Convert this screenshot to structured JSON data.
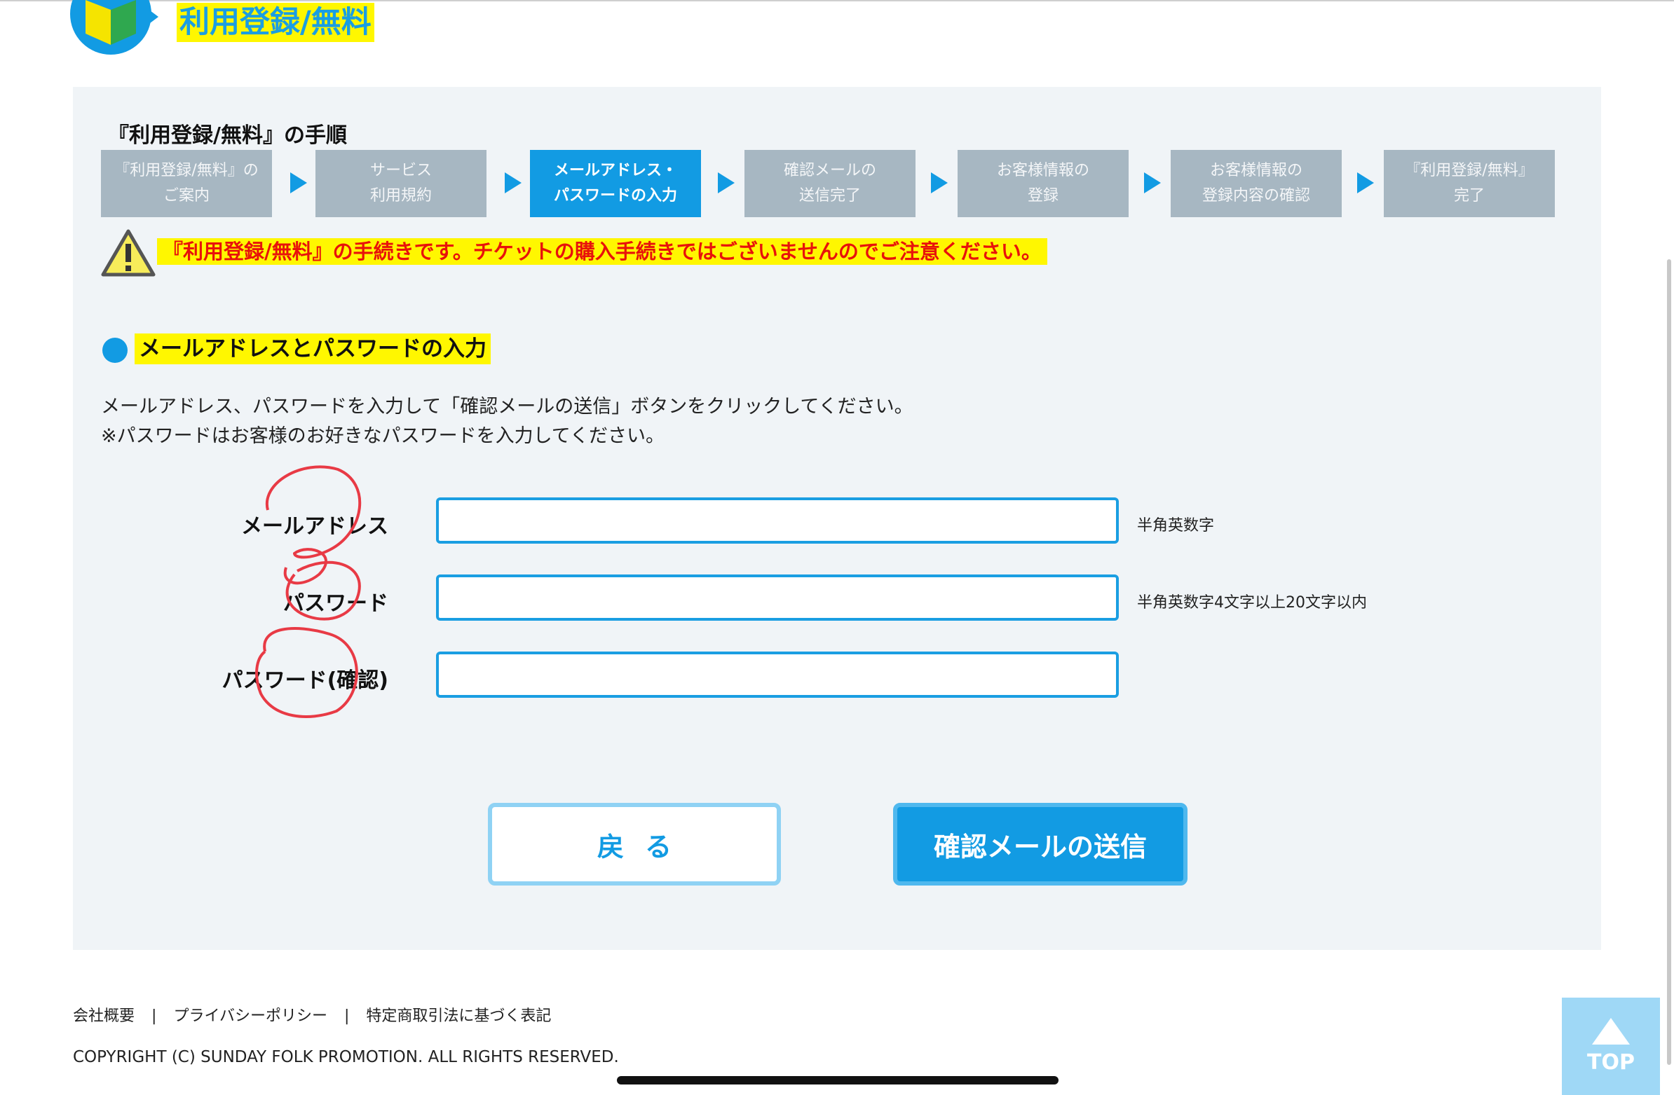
{
  "header": {
    "title": "利用登録/無料"
  },
  "steps": {
    "title": "『利用登録/無料』の手順",
    "items": [
      {
        "label": "『利用登録/無料』の\nご案内"
      },
      {
        "label": "サービス\n利用規約"
      },
      {
        "label": "メールアドレス・\nパスワードの入力"
      },
      {
        "label": "確認メールの\n送信完了"
      },
      {
        "label": "お客様情報の\n登録"
      },
      {
        "label": "お客様情報の\n登録内容の確認"
      },
      {
        "label": "『利用登録/無料』\n完了"
      }
    ],
    "active_index": 2
  },
  "warning": {
    "text": "『利用登録/無料』の手続きです。チケットの購入手続きではございませんのでご注意ください。"
  },
  "section": {
    "title": "メールアドレスとパスワードの入力",
    "description_line1": "メールアドレス、パスワードを入力して「確認メールの送信」ボタンをクリックしてください。",
    "description_line2": "※パスワードはお客様のお好きなパスワードを入力してください。"
  },
  "form": {
    "email": {
      "label": "メールアドレス",
      "value": "",
      "note": "半角英数字"
    },
    "password": {
      "label": "パスワード",
      "value": "",
      "note": "半角英数字4文字以上20文字以内"
    },
    "password_confirm": {
      "label": "パスワード(確認)",
      "value": "",
      "note": ""
    }
  },
  "buttons": {
    "back": "戻る",
    "send": "確認メールの送信"
  },
  "footer": {
    "links": [
      "会社概要",
      "プライバシーポリシー",
      "特定商取引法に基づく表記"
    ],
    "separator": "|",
    "copyright": "COPYRIGHT (C) SUNDAY FOLK PROMOTION. ALL RIGHTS RESERVED."
  },
  "top_button": {
    "label": "TOP"
  },
  "colors": {
    "accent": "#129be3",
    "highlight": "#fff700",
    "warning_text": "#e8120b",
    "step_inactive": "#a7b7c2",
    "panel_bg": "#f0f4f7"
  },
  "icons": {
    "header": "beginner-mark-icon",
    "warning": "warning-triangle-icon",
    "section": "bullet-dot-icon",
    "top": "arrow-up-icon"
  }
}
